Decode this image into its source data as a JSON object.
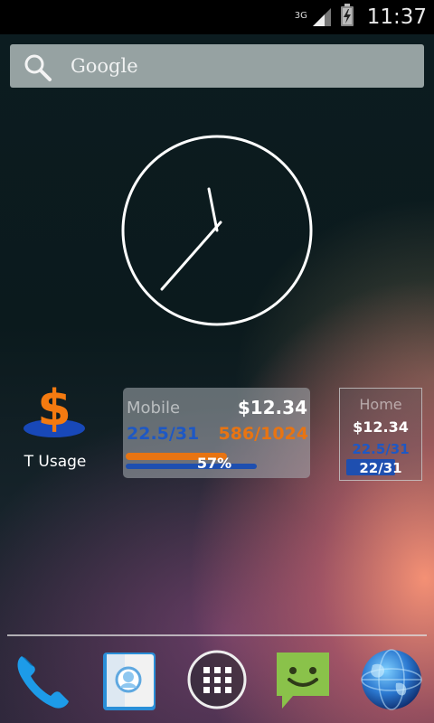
{
  "status_bar": {
    "network_type": "3G",
    "time": "11:37",
    "icons": [
      "signal-icon",
      "battery-icon"
    ]
  },
  "search": {
    "label": "Google",
    "icon": "search-icon"
  },
  "clock_widget": {
    "icon": "analog-clock",
    "time": "11:37"
  },
  "t_usage_app": {
    "label": "T Usage",
    "icon": "dollar-icon",
    "colors": {
      "dollar": "#f47a10",
      "base": "#1848b8"
    }
  },
  "mobile_widget": {
    "title": "Mobile",
    "cost": "$12.34",
    "days": "22.5/31",
    "data": "586/1024",
    "percent": "57%",
    "data_fraction": 0.57,
    "days_fraction": 0.726,
    "colors": {
      "days": "#1e58c4",
      "data": "#e87412"
    }
  },
  "home_widget": {
    "title": "Home",
    "cost": "$12.34",
    "days_1": "22.5/31",
    "days_2": "22/31",
    "days_fraction": 0.71
  },
  "dock": [
    {
      "name": "phone-icon"
    },
    {
      "name": "contacts-icon"
    },
    {
      "name": "app-drawer-icon"
    },
    {
      "name": "messaging-icon"
    },
    {
      "name": "browser-globe-icon"
    }
  ]
}
